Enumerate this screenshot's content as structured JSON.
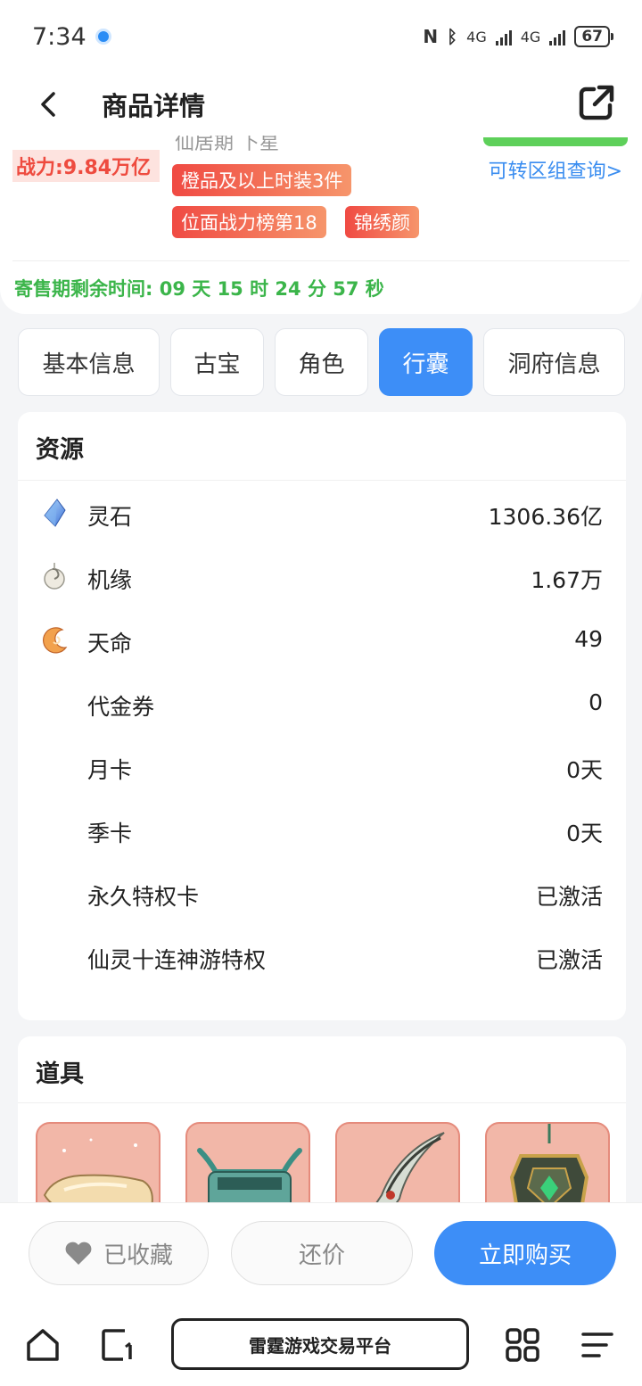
{
  "status_bar": {
    "time": "7:34",
    "battery": "67",
    "network": "4G"
  },
  "header": {
    "title": "商品详情"
  },
  "summary": {
    "cut_text": "仙居期 下星",
    "power_label": "战力: ",
    "power_value": "9.84万亿",
    "transfer_link": "可转区组查询>",
    "tags": [
      "橙品及以上时装3件",
      "位面战力榜第18",
      "锦绣颜"
    ],
    "countdown_label": "寄售期剩余时间: ",
    "countdown_value": "09 天 15 时 24 分 57 秒"
  },
  "tabs": [
    {
      "label": "基本信息",
      "active": false
    },
    {
      "label": "古宝",
      "active": false
    },
    {
      "label": "角色",
      "active": false
    },
    {
      "label": "行囊",
      "active": true
    },
    {
      "label": "洞府信息",
      "active": false
    }
  ],
  "resources": {
    "title": "资源",
    "rows": [
      {
        "label": "灵石",
        "value": "1306.36亿",
        "icon": "crystal-icon"
      },
      {
        "label": "机缘",
        "value": "1.67万",
        "icon": "jade-pendant-icon"
      },
      {
        "label": "天命",
        "value": "49",
        "icon": "crescent-icon"
      },
      {
        "label": "代金券",
        "value": "0",
        "icon": ""
      },
      {
        "label": "月卡",
        "value": "0天",
        "icon": ""
      },
      {
        "label": "季卡",
        "value": "0天",
        "icon": ""
      },
      {
        "label": "永久特权卡",
        "value": "已激活",
        "icon": ""
      },
      {
        "label": "仙灵十连神游特权",
        "value": "已激活",
        "icon": ""
      }
    ]
  },
  "items": {
    "title": "道具",
    "tiles": [
      "gold-ingot-icon",
      "bronze-cauldron-icon",
      "jade-blade-icon",
      "talisman-pendant-icon"
    ]
  },
  "actions": {
    "favorite": "已收藏",
    "bargain": "还价",
    "buy": "立即购买"
  },
  "browser": {
    "site_name": "雷霆游戏交易平台"
  },
  "colors": {
    "accent": "#3d8ef7",
    "power": "#ee4b3f",
    "countdown": "#3bb54a",
    "tile_bg": "#f2b7a8"
  }
}
